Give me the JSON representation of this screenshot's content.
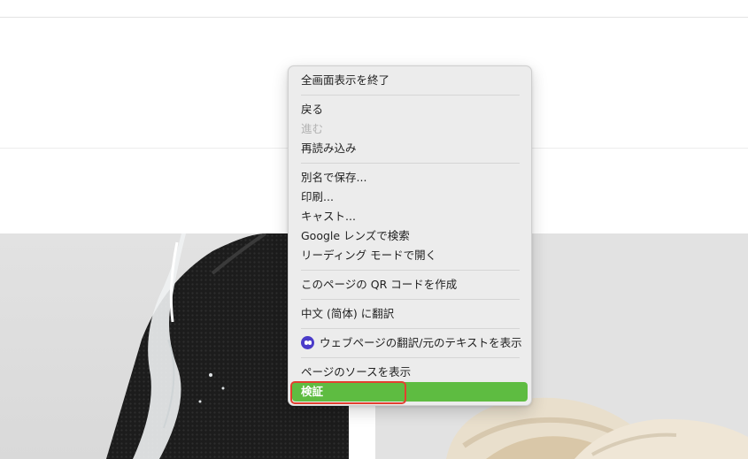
{
  "context_menu": {
    "items": [
      {
        "label": "全画面表示を終了"
      },
      {
        "label": "戻る"
      },
      {
        "label": "進む"
      },
      {
        "label": "再読み込み"
      },
      {
        "label": "別名で保存..."
      },
      {
        "label": "印刷..."
      },
      {
        "label": "キャスト..."
      },
      {
        "label": "Google レンズで検索"
      },
      {
        "label": "リーディング モードで開く"
      },
      {
        "label": "このページの QR コードを作成"
      },
      {
        "label": "中文 (简体) に翻訳"
      },
      {
        "label": "ウェブページの翻訳/元のテキストを表示",
        "icon": "translate-extension-icon"
      },
      {
        "label": "ページのソースを表示"
      },
      {
        "label": "検証"
      }
    ],
    "highlight_color": "#5ebc41",
    "focus_ring_color": "#e2402f"
  }
}
